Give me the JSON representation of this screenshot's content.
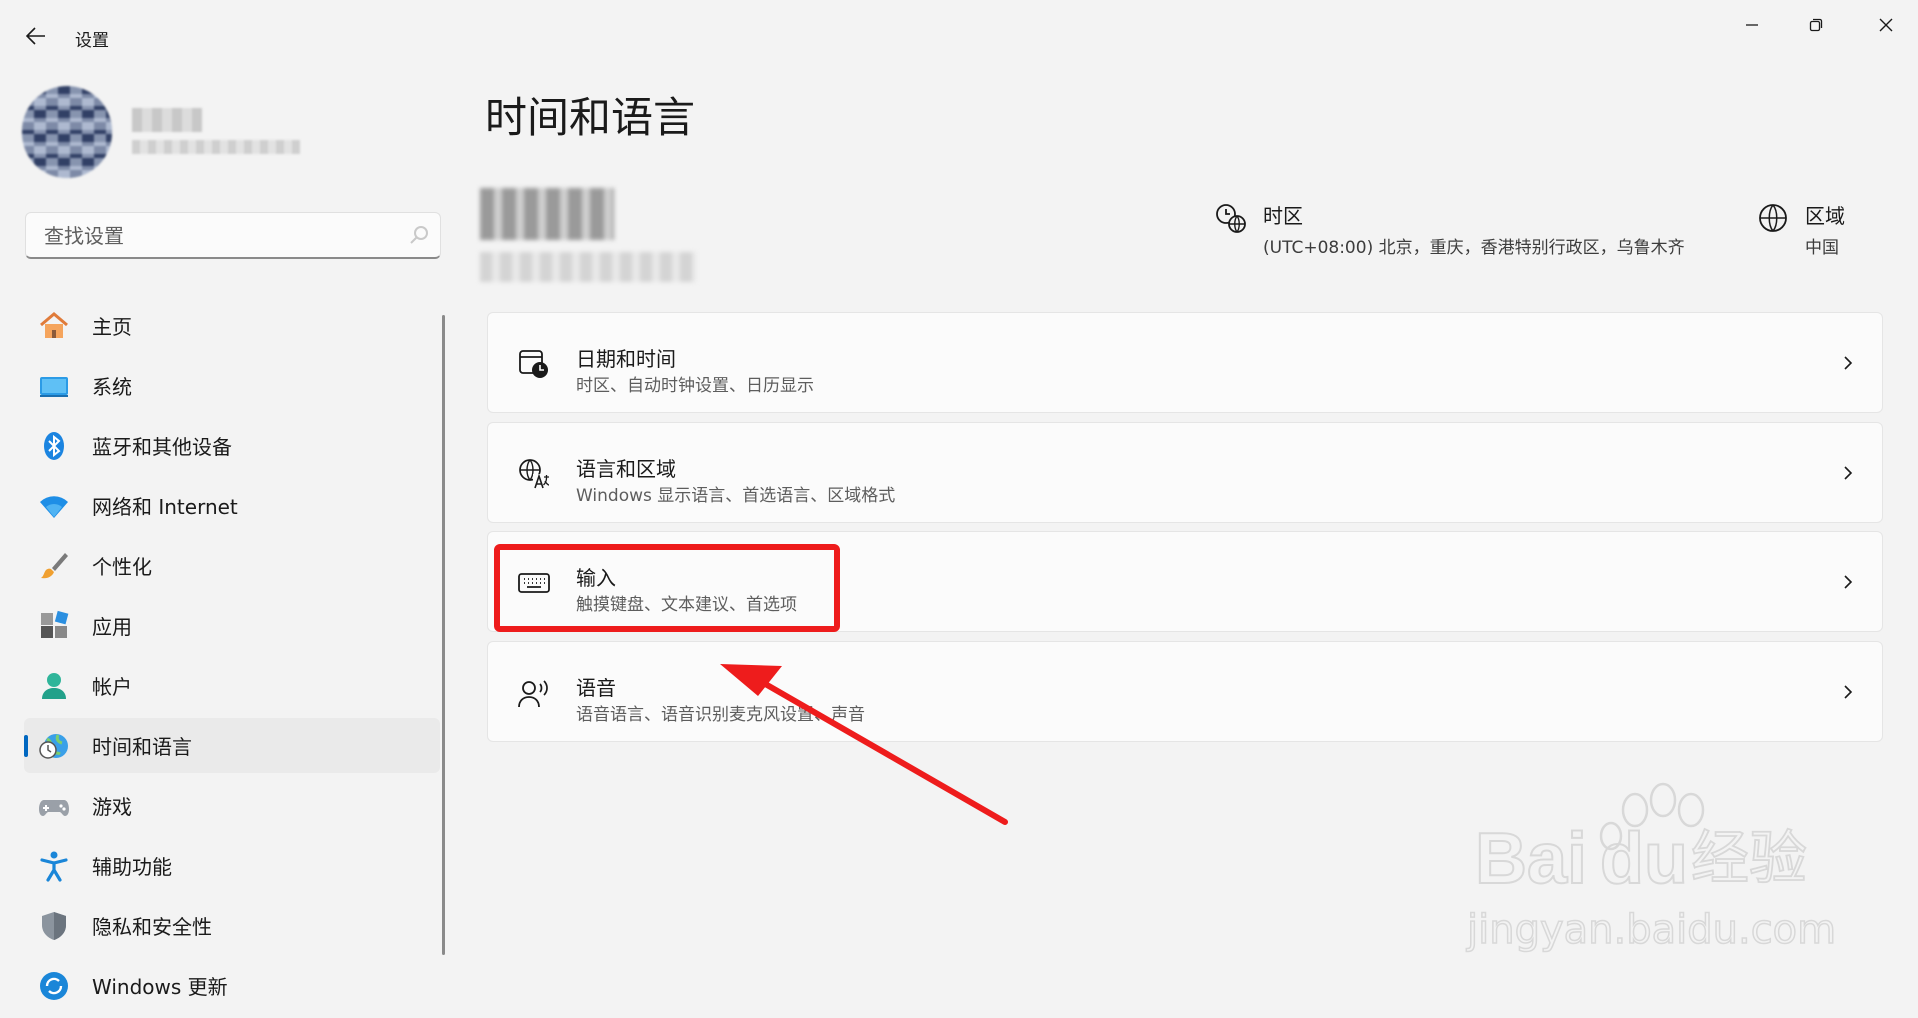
{
  "window": {
    "title": "设置"
  },
  "profile": {
    "name": "",
    "email": ""
  },
  "search": {
    "placeholder": "查找设置"
  },
  "nav": {
    "items": [
      {
        "label": "主页",
        "icon": "home-icon"
      },
      {
        "label": "系统",
        "icon": "system-icon"
      },
      {
        "label": "蓝牙和其他设备",
        "icon": "bluetooth-icon"
      },
      {
        "label": "网络和 Internet",
        "icon": "wifi-icon"
      },
      {
        "label": "个性化",
        "icon": "brush-icon"
      },
      {
        "label": "应用",
        "icon": "apps-icon"
      },
      {
        "label": "帐户",
        "icon": "account-icon"
      },
      {
        "label": "时间和语言",
        "icon": "time-language-icon",
        "active": true
      },
      {
        "label": "游戏",
        "icon": "gamepad-icon"
      },
      {
        "label": "辅助功能",
        "icon": "accessibility-icon"
      },
      {
        "label": "隐私和安全性",
        "icon": "shield-icon"
      },
      {
        "label": "Windows 更新",
        "icon": "update-icon"
      }
    ]
  },
  "main": {
    "title": "时间和语言",
    "timezone": {
      "title": "时区",
      "value": "(UTC+08:00) 北京，重庆，香港特别行政区，乌鲁木齐"
    },
    "region": {
      "title": "区域",
      "value": "中国"
    },
    "cards": [
      {
        "title": "日期和时间",
        "subtitle": "时区、自动时钟设置、日历显示",
        "icon": "calendar-clock-icon"
      },
      {
        "title": "语言和区域",
        "subtitle": "Windows 显示语言、首选语言、区域格式",
        "icon": "language-icon"
      },
      {
        "title": "输入",
        "subtitle": "触摸键盘、文本建议、首选项",
        "icon": "keyboard-icon"
      },
      {
        "title": "语音",
        "subtitle": "语音语言、语音识别麦克风设置、声音",
        "icon": "speech-icon"
      }
    ]
  },
  "watermark": {
    "brand": "Bai",
    "brand2": "du",
    "cn": "经验",
    "url": "jingyan.baidu.com"
  },
  "colors": {
    "accent": "#0067c0",
    "annotation": "#ee1c1c",
    "background": "#f3f3f3"
  }
}
